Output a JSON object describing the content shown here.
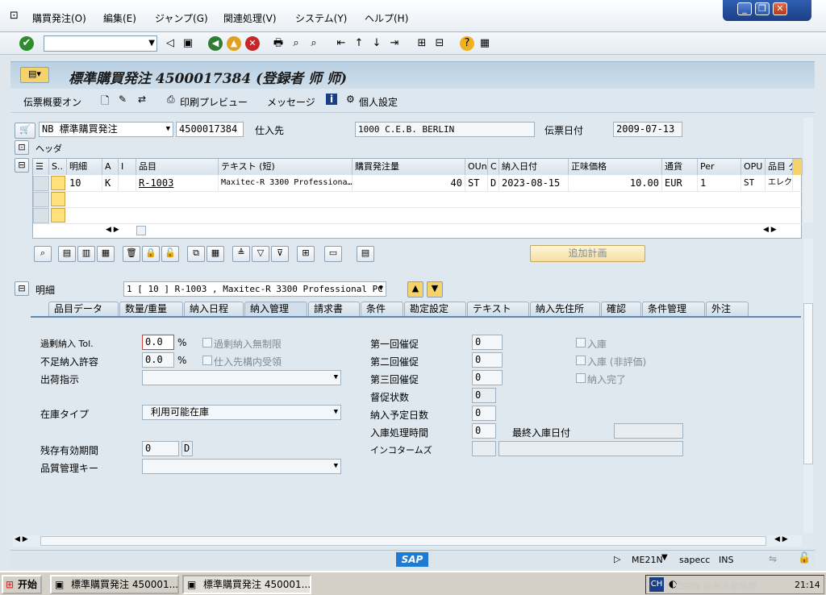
{
  "menu": [
    "購買発注(O)",
    "編集(E)",
    "ジャンプ(G)",
    "関連処理(V)",
    "システム(Y)",
    "ヘルプ(H)"
  ],
  "title": "標準購買発注 4500017384 (登録者 师 师)",
  "app_toolbar": {
    "summary_on": "伝票概要オン",
    "print_preview": "印刷プレビュー",
    "messages": "メッセージ",
    "personal_settings": "個人設定"
  },
  "header": {
    "doc_type": "NB 標準購買発注",
    "po_number": "4500017384",
    "vendor_label": "仕入先",
    "vendor_value": "1000 C.E.B. BERLIN",
    "doc_date_label": "伝票日付",
    "doc_date_value": "2009-07-13",
    "header_label": "ヘッダ"
  },
  "table": {
    "columns": [
      "S..",
      "明細",
      "A",
      "I",
      "品目",
      "テキスト (短)",
      "購買発注量",
      "OUn",
      "C",
      "納入日付",
      "正味価格",
      "通貨",
      "Per",
      "OPU",
      "品目 グ"
    ],
    "rows": [
      {
        "item": "10",
        "a": "K",
        "i": "",
        "material": "R-1003",
        "text": "Maxitec-R 3300 Professiona…",
        "qty": "40",
        "oun": "ST",
        "c": "D",
        "delivery": "2023-08-15",
        "price": "10.00",
        "currency": "EUR",
        "per": "1",
        "opu": "ST",
        "group": "エレク"
      }
    ],
    "add_plan_button": "追加計画"
  },
  "detail": {
    "label": "明細",
    "selector": "1 [ 10 ] R-1003 , Maxitec-R 3300 Professional PC"
  },
  "tabs": [
    "品目データ",
    "数量/重量",
    "納入日程",
    "納入管理",
    "請求書",
    "条件",
    "勘定設定",
    "テキスト",
    "納入先住所",
    "確認",
    "条件管理",
    "外注"
  ],
  "active_tab": "納入管理",
  "delivery_control": {
    "overdelivery_tol_label": "過剰納入 Tol.",
    "overdelivery_tol_value": "0.0",
    "unlimited_over_label": "過剰納入無制限",
    "underdelivery_label": "不足納入許容",
    "underdelivery_value": "0.0",
    "percent": "%",
    "gr_at_vendor_label": "仕入先構内受領",
    "shipping_instr_label": "出荷指示",
    "shipping_instr_value": "",
    "stock_type_label": "在庫タイプ",
    "stock_type_value": "利用可能在庫",
    "remaining_shelf_label": "残存有効期間",
    "remaining_shelf_value": "0",
    "remaining_shelf_unit": "D",
    "qm_key_label": "品質管理キー",
    "qm_key_value": "",
    "reminder1_label": "第一回催促",
    "reminder1_value": "0",
    "reminder2_label": "第二回催促",
    "reminder2_value": "0",
    "reminder3_label": "第三回催促",
    "reminder3_value": "0",
    "urging_status_label": "督促状数",
    "urging_status_value": "0",
    "planned_days_label": "納入予定日数",
    "planned_days_value": "0",
    "gr_proc_time_label": "入庫処理時間",
    "gr_proc_time_value": "0",
    "last_gr_date_label": "最終入庫日付",
    "last_gr_date_value": "",
    "incoterms_label": "インコタームズ",
    "goods_receipt_label": "入庫",
    "gr_non_valuated_label": "入庫 (非評価)",
    "delivery_completed_label": "納入完了"
  },
  "status": {
    "sap": "SAP",
    "tcode": "ME21N",
    "system": "sapecc",
    "mode": "INS"
  },
  "taskbar": {
    "start": "开始",
    "task1": "標準購買発注 450001...",
    "task2": "標準購買発注 450001...",
    "lang": "CH",
    "clock": "21:14",
    "watermark": "CSDN @东方老柚根"
  },
  "colors": {
    "title_bg": "#b9d0e3",
    "tab_line": "#5d87b0",
    "sap_logo": "#1f7ad1"
  }
}
